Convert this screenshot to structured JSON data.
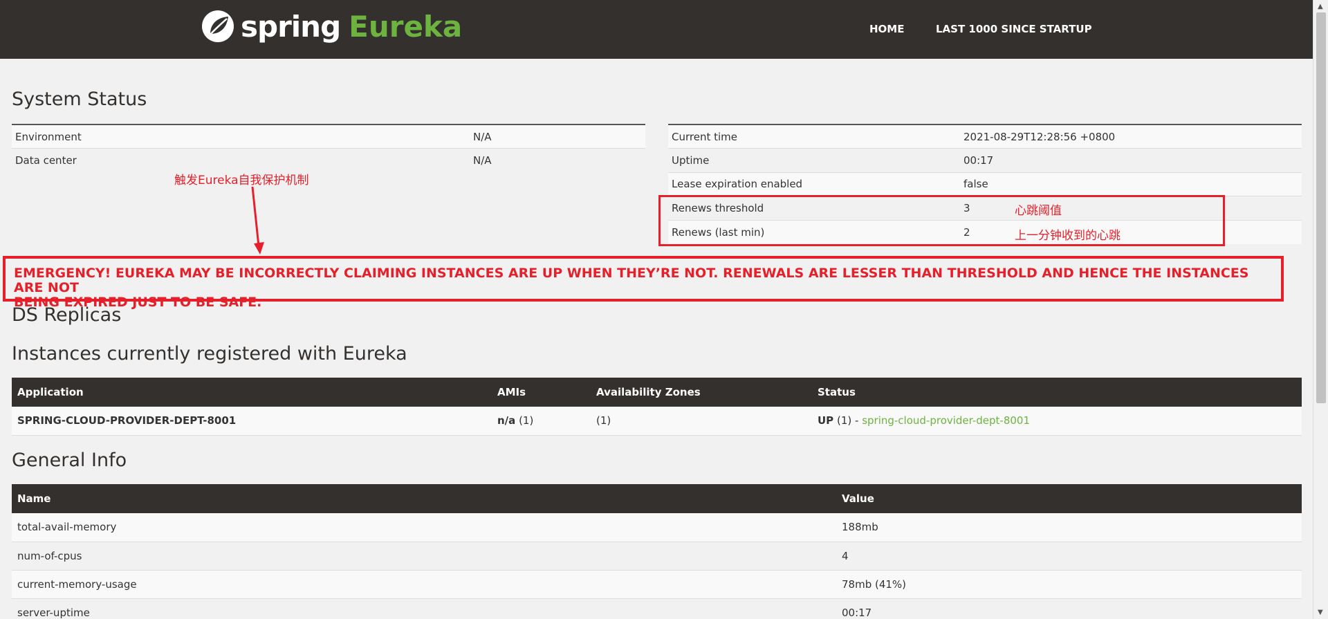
{
  "nav": {
    "brand_spring": "spring",
    "brand_eureka": "Eureka",
    "home": "HOME",
    "last1000": "LAST 1000 SINCE STARTUP"
  },
  "system_status": {
    "title": "System Status",
    "left": [
      {
        "label": "Environment",
        "value": "N/A"
      },
      {
        "label": "Data center",
        "value": "N/A"
      }
    ],
    "right": [
      {
        "label": "Current time",
        "value": "2021-08-29T12:28:56 +0800"
      },
      {
        "label": "Uptime",
        "value": "00:17"
      },
      {
        "label": "Lease expiration enabled",
        "value": "false"
      },
      {
        "label": "Renews threshold",
        "value": "3"
      },
      {
        "label": "Renews (last min)",
        "value": "2"
      }
    ]
  },
  "annotations": {
    "self_preservation": "触发Eureka自我保护机制",
    "heartbeat_threshold": "心跳阈值",
    "last_min_heartbeat": "上一分钟收到的心跳"
  },
  "emergency": {
    "line1": "EMERGENCY! EUREKA MAY BE INCORRECTLY CLAIMING INSTANCES ARE UP WHEN THEY’RE NOT. RENEWALS ARE LESSER THAN THRESHOLD AND HENCE THE INSTANCES ARE NOT",
    "line2": "BEING EXPIRED JUST TO BE SAFE."
  },
  "ds_replicas": {
    "title": "DS Replicas"
  },
  "instances": {
    "title": "Instances currently registered with Eureka",
    "headers": [
      "Application",
      "AMIs",
      "Availability Zones",
      "Status"
    ],
    "rows": [
      {
        "application": "SPRING-CLOUD-PROVIDER-DEPT-8001",
        "ami_bold": "n/a",
        "ami_count": "(1)",
        "zones": "(1)",
        "status_bold": "UP",
        "status_count": "(1) -",
        "status_link": "spring-cloud-provider-dept-8001"
      }
    ]
  },
  "general_info": {
    "title": "General Info",
    "headers": [
      "Name",
      "Value"
    ],
    "rows": [
      {
        "name": "total-avail-memory",
        "value": "188mb"
      },
      {
        "name": "num-of-cpus",
        "value": "4"
      },
      {
        "name": "current-memory-usage",
        "value": "78mb (41%)"
      },
      {
        "name": "server-uptime",
        "value": "00:17"
      }
    ]
  },
  "colors": {
    "nav_bg": "#34302d",
    "accent_green": "#6db33f",
    "annotation_red": "#e5202a"
  }
}
